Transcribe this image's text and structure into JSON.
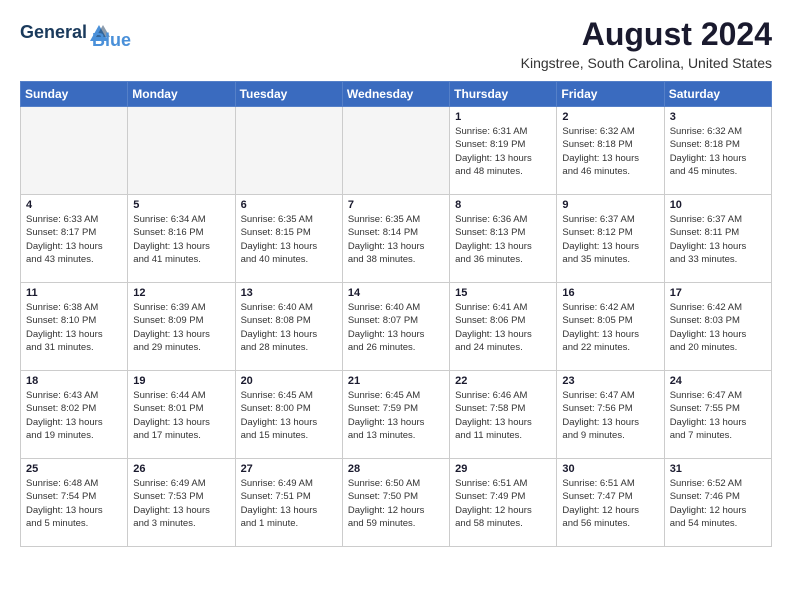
{
  "header": {
    "logo_line1": "General",
    "logo_line2": "Blue",
    "main_title": "August 2024",
    "subtitle": "Kingstree, South Carolina, United States"
  },
  "weekdays": [
    "Sunday",
    "Monday",
    "Tuesday",
    "Wednesday",
    "Thursday",
    "Friday",
    "Saturday"
  ],
  "weeks": [
    [
      {
        "day": "",
        "info": ""
      },
      {
        "day": "",
        "info": ""
      },
      {
        "day": "",
        "info": ""
      },
      {
        "day": "",
        "info": ""
      },
      {
        "day": "1",
        "info": "Sunrise: 6:31 AM\nSunset: 8:19 PM\nDaylight: 13 hours\nand 48 minutes."
      },
      {
        "day": "2",
        "info": "Sunrise: 6:32 AM\nSunset: 8:18 PM\nDaylight: 13 hours\nand 46 minutes."
      },
      {
        "day": "3",
        "info": "Sunrise: 6:32 AM\nSunset: 8:18 PM\nDaylight: 13 hours\nand 45 minutes."
      }
    ],
    [
      {
        "day": "4",
        "info": "Sunrise: 6:33 AM\nSunset: 8:17 PM\nDaylight: 13 hours\nand 43 minutes."
      },
      {
        "day": "5",
        "info": "Sunrise: 6:34 AM\nSunset: 8:16 PM\nDaylight: 13 hours\nand 41 minutes."
      },
      {
        "day": "6",
        "info": "Sunrise: 6:35 AM\nSunset: 8:15 PM\nDaylight: 13 hours\nand 40 minutes."
      },
      {
        "day": "7",
        "info": "Sunrise: 6:35 AM\nSunset: 8:14 PM\nDaylight: 13 hours\nand 38 minutes."
      },
      {
        "day": "8",
        "info": "Sunrise: 6:36 AM\nSunset: 8:13 PM\nDaylight: 13 hours\nand 36 minutes."
      },
      {
        "day": "9",
        "info": "Sunrise: 6:37 AM\nSunset: 8:12 PM\nDaylight: 13 hours\nand 35 minutes."
      },
      {
        "day": "10",
        "info": "Sunrise: 6:37 AM\nSunset: 8:11 PM\nDaylight: 13 hours\nand 33 minutes."
      }
    ],
    [
      {
        "day": "11",
        "info": "Sunrise: 6:38 AM\nSunset: 8:10 PM\nDaylight: 13 hours\nand 31 minutes."
      },
      {
        "day": "12",
        "info": "Sunrise: 6:39 AM\nSunset: 8:09 PM\nDaylight: 13 hours\nand 29 minutes."
      },
      {
        "day": "13",
        "info": "Sunrise: 6:40 AM\nSunset: 8:08 PM\nDaylight: 13 hours\nand 28 minutes."
      },
      {
        "day": "14",
        "info": "Sunrise: 6:40 AM\nSunset: 8:07 PM\nDaylight: 13 hours\nand 26 minutes."
      },
      {
        "day": "15",
        "info": "Sunrise: 6:41 AM\nSunset: 8:06 PM\nDaylight: 13 hours\nand 24 minutes."
      },
      {
        "day": "16",
        "info": "Sunrise: 6:42 AM\nSunset: 8:05 PM\nDaylight: 13 hours\nand 22 minutes."
      },
      {
        "day": "17",
        "info": "Sunrise: 6:42 AM\nSunset: 8:03 PM\nDaylight: 13 hours\nand 20 minutes."
      }
    ],
    [
      {
        "day": "18",
        "info": "Sunrise: 6:43 AM\nSunset: 8:02 PM\nDaylight: 13 hours\nand 19 minutes."
      },
      {
        "day": "19",
        "info": "Sunrise: 6:44 AM\nSunset: 8:01 PM\nDaylight: 13 hours\nand 17 minutes."
      },
      {
        "day": "20",
        "info": "Sunrise: 6:45 AM\nSunset: 8:00 PM\nDaylight: 13 hours\nand 15 minutes."
      },
      {
        "day": "21",
        "info": "Sunrise: 6:45 AM\nSunset: 7:59 PM\nDaylight: 13 hours\nand 13 minutes."
      },
      {
        "day": "22",
        "info": "Sunrise: 6:46 AM\nSunset: 7:58 PM\nDaylight: 13 hours\nand 11 minutes."
      },
      {
        "day": "23",
        "info": "Sunrise: 6:47 AM\nSunset: 7:56 PM\nDaylight: 13 hours\nand 9 minutes."
      },
      {
        "day": "24",
        "info": "Sunrise: 6:47 AM\nSunset: 7:55 PM\nDaylight: 13 hours\nand 7 minutes."
      }
    ],
    [
      {
        "day": "25",
        "info": "Sunrise: 6:48 AM\nSunset: 7:54 PM\nDaylight: 13 hours\nand 5 minutes."
      },
      {
        "day": "26",
        "info": "Sunrise: 6:49 AM\nSunset: 7:53 PM\nDaylight: 13 hours\nand 3 minutes."
      },
      {
        "day": "27",
        "info": "Sunrise: 6:49 AM\nSunset: 7:51 PM\nDaylight: 13 hours\nand 1 minute."
      },
      {
        "day": "28",
        "info": "Sunrise: 6:50 AM\nSunset: 7:50 PM\nDaylight: 12 hours\nand 59 minutes."
      },
      {
        "day": "29",
        "info": "Sunrise: 6:51 AM\nSunset: 7:49 PM\nDaylight: 12 hours\nand 58 minutes."
      },
      {
        "day": "30",
        "info": "Sunrise: 6:51 AM\nSunset: 7:47 PM\nDaylight: 12 hours\nand 56 minutes."
      },
      {
        "day": "31",
        "info": "Sunrise: 6:52 AM\nSunset: 7:46 PM\nDaylight: 12 hours\nand 54 minutes."
      }
    ]
  ]
}
